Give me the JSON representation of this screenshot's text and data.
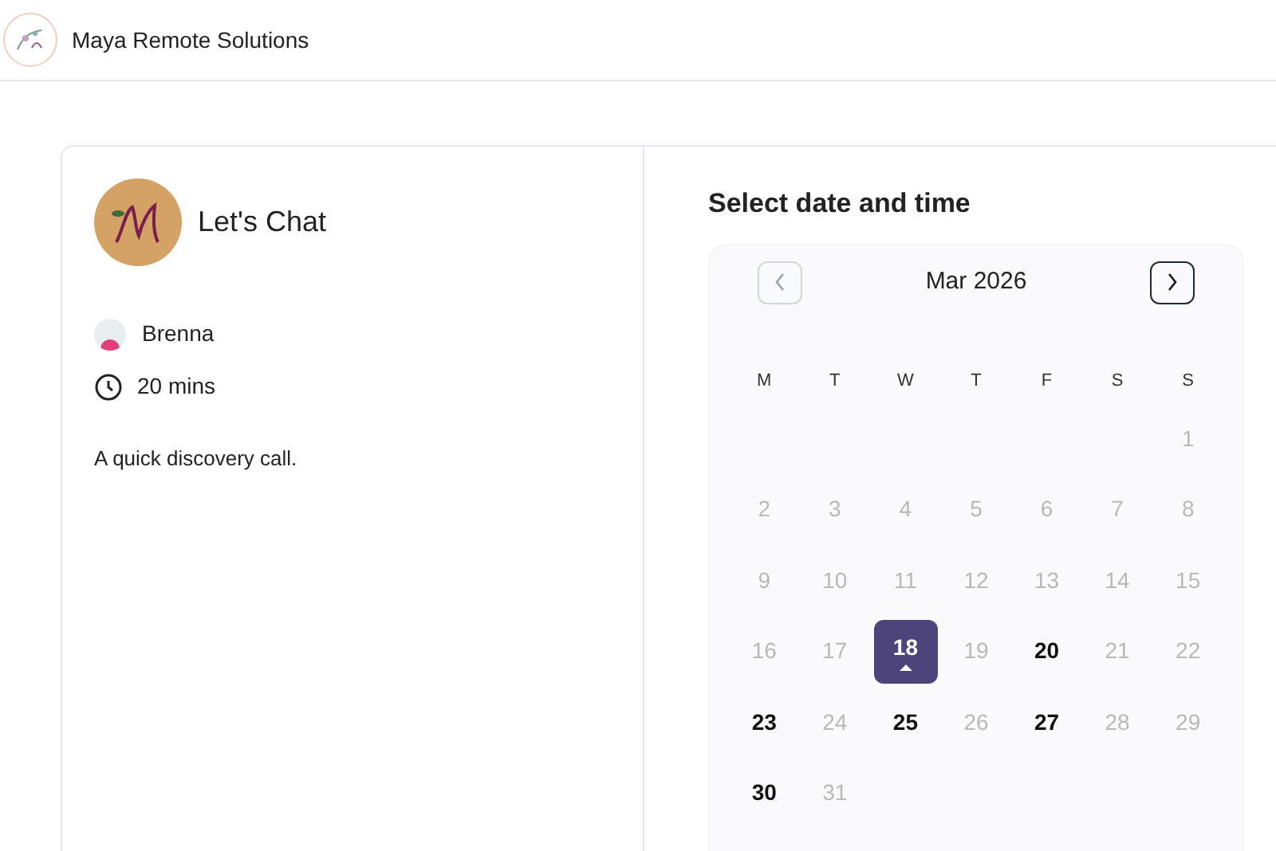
{
  "header": {
    "brand": "Maya Remote Solutions"
  },
  "event": {
    "title": "Let's Chat",
    "host": "Brenna",
    "duration": "20 mins",
    "description": "A quick discovery call."
  },
  "picker": {
    "title": "Select date and time",
    "month": "Mar 2026",
    "prev": {
      "disabled": true
    },
    "next": {
      "disabled": false
    },
    "weekdays": [
      "M",
      "T",
      "W",
      "T",
      "F",
      "S",
      "S"
    ],
    "weeks": [
      {
        "right_aligned": true,
        "days": [
          {
            "label": "1",
            "available": false,
            "selected": false
          }
        ]
      },
      {
        "days": [
          {
            "label": "2",
            "available": false,
            "selected": false
          },
          {
            "label": "3",
            "available": false,
            "selected": false
          },
          {
            "label": "4",
            "available": false,
            "selected": false
          },
          {
            "label": "5",
            "available": false,
            "selected": false
          },
          {
            "label": "6",
            "available": false,
            "selected": false
          },
          {
            "label": "7",
            "available": false,
            "selected": false
          },
          {
            "label": "8",
            "available": false,
            "selected": false
          }
        ]
      },
      {
        "days": [
          {
            "label": "9",
            "available": false,
            "selected": false
          },
          {
            "label": "10",
            "available": false,
            "selected": false
          },
          {
            "label": "11",
            "available": false,
            "selected": false
          },
          {
            "label": "12",
            "available": false,
            "selected": false
          },
          {
            "label": "13",
            "available": false,
            "selected": false
          },
          {
            "label": "14",
            "available": false,
            "selected": false
          },
          {
            "label": "15",
            "available": false,
            "selected": false
          }
        ]
      },
      {
        "days": [
          {
            "label": "16",
            "available": false,
            "selected": false
          },
          {
            "label": "17",
            "available": false,
            "selected": false
          },
          {
            "label": "18",
            "available": true,
            "selected": true
          },
          {
            "label": "19",
            "available": false,
            "selected": false
          },
          {
            "label": "20",
            "available": true,
            "selected": false
          },
          {
            "label": "21",
            "available": false,
            "selected": false
          },
          {
            "label": "22",
            "available": false,
            "selected": false
          }
        ]
      },
      {
        "days": [
          {
            "label": "23",
            "available": true,
            "selected": false
          },
          {
            "label": "24",
            "available": false,
            "selected": false
          },
          {
            "label": "25",
            "available": true,
            "selected": false
          },
          {
            "label": "26",
            "available": false,
            "selected": false
          },
          {
            "label": "27",
            "available": true,
            "selected": false
          },
          {
            "label": "28",
            "available": false,
            "selected": false
          },
          {
            "label": "29",
            "available": false,
            "selected": false
          }
        ]
      },
      {
        "right_aligned": false,
        "days": [
          {
            "label": "30",
            "available": true,
            "selected": false
          },
          {
            "label": "31",
            "available": false,
            "selected": false
          }
        ]
      }
    ]
  }
}
